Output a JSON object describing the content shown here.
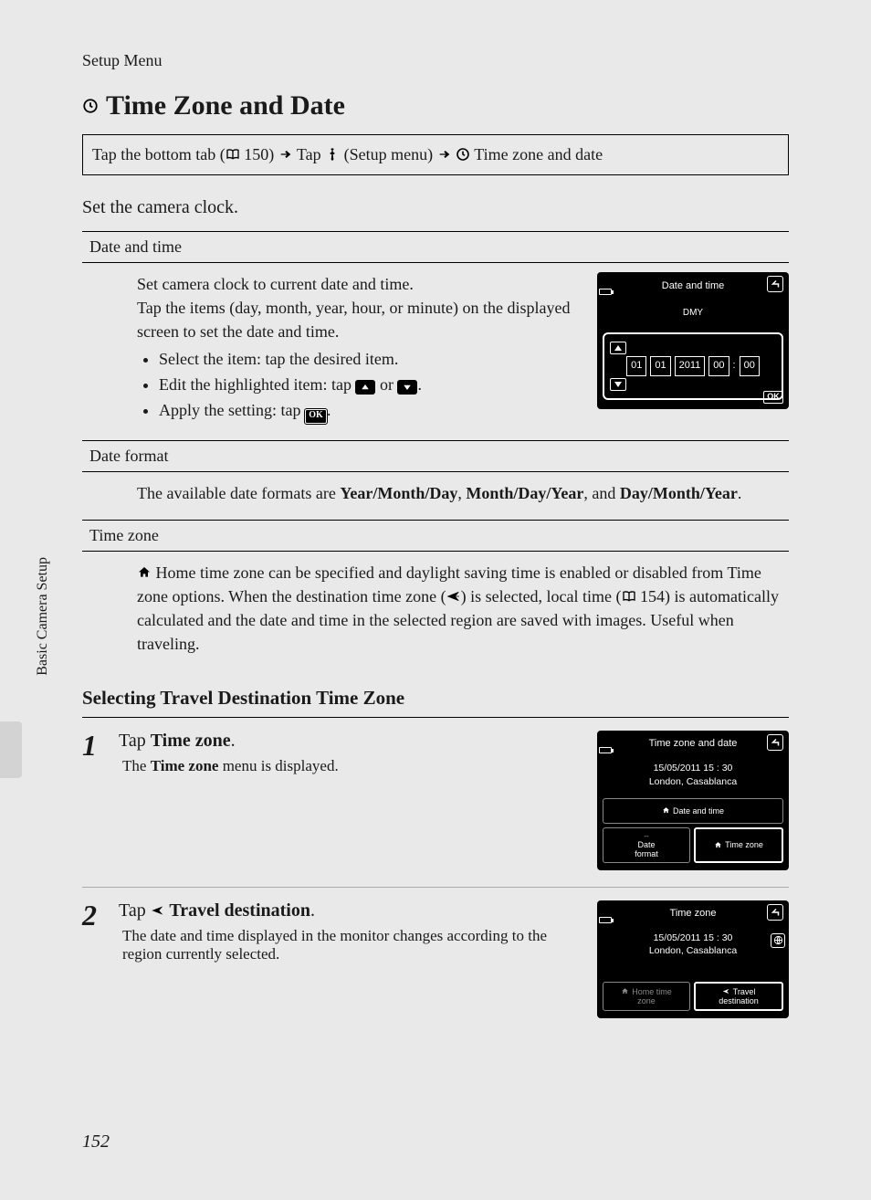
{
  "page": {
    "crumb": "Setup Menu",
    "title": "Time Zone and Date",
    "nav_parts": {
      "p1": "Tap the bottom tab (",
      "p2": " 150) ",
      "p3": " Tap ",
      "p4": " (Setup menu) ",
      "p5": " Time zone and date"
    },
    "intro": "Set the camera clock.",
    "side_text": "Basic Camera Setup",
    "number": "152"
  },
  "sections": {
    "date_time": {
      "head": "Date and time",
      "p1": "Set camera clock to current date and time.",
      "p2": "Tap the items (day, month, year, hour, or minute) on the displayed screen to set the date and time.",
      "b1": "Select the item: tap the desired item.",
      "b2a": "Edit the highlighted item: tap ",
      "b2b": " or ",
      "b2c": ".",
      "b3a": "Apply the setting: tap ",
      "b3b": "."
    },
    "date_format": {
      "head": "Date format",
      "p_a": "The available date formats are ",
      "f1": "Year/Month/Day",
      "sep1": ", ",
      "f2": "Month/Day/Year",
      "sep2": ", and ",
      "f3": "Day/Month/Year",
      "p_end": "."
    },
    "time_zone": {
      "head": "Time zone",
      "p_a": " Home time zone can be specified and daylight saving time is enabled or disabled from Time zone options. When the destination time zone (",
      "p_b": ") is selected, local time (",
      "p_c": " 154) is automatically calculated and the date and time in the selected region are saved with images. Useful when traveling."
    }
  },
  "subhead": "Selecting Travel Destination Time Zone",
  "steps": {
    "s1": {
      "num": "1",
      "title_a": "Tap ",
      "title_b": "Time zone",
      "title_c": ".",
      "desc_a": "The ",
      "desc_b": "Time zone",
      "desc_c": " menu is displayed."
    },
    "s2": {
      "num": "2",
      "title_a": "Tap ",
      "title_b": " Travel destination",
      "title_c": ".",
      "desc": "The date and time displayed in the monitor changes according to the region currently selected."
    }
  },
  "lcd1": {
    "title": "Date and time",
    "fmt": "DMY",
    "d": "01",
    "m": "01",
    "y": "2011",
    "h": "00",
    "min": "00",
    "ok": "OK"
  },
  "lcd2": {
    "title": "Time zone and date",
    "datetime": "15/05/2011   15 : 30",
    "loc": "London, Casablanca",
    "btn1": "Date and time",
    "btn2a": "Date",
    "btn2b": "format",
    "btn3": "Time zone"
  },
  "lcd3": {
    "title": "Time zone",
    "datetime": "15/05/2011   15 : 30",
    "loc": "London, Casablanca",
    "btn1a": "Home time",
    "btn1b": "zone",
    "btn2a": "Travel",
    "btn2b": "destination"
  }
}
